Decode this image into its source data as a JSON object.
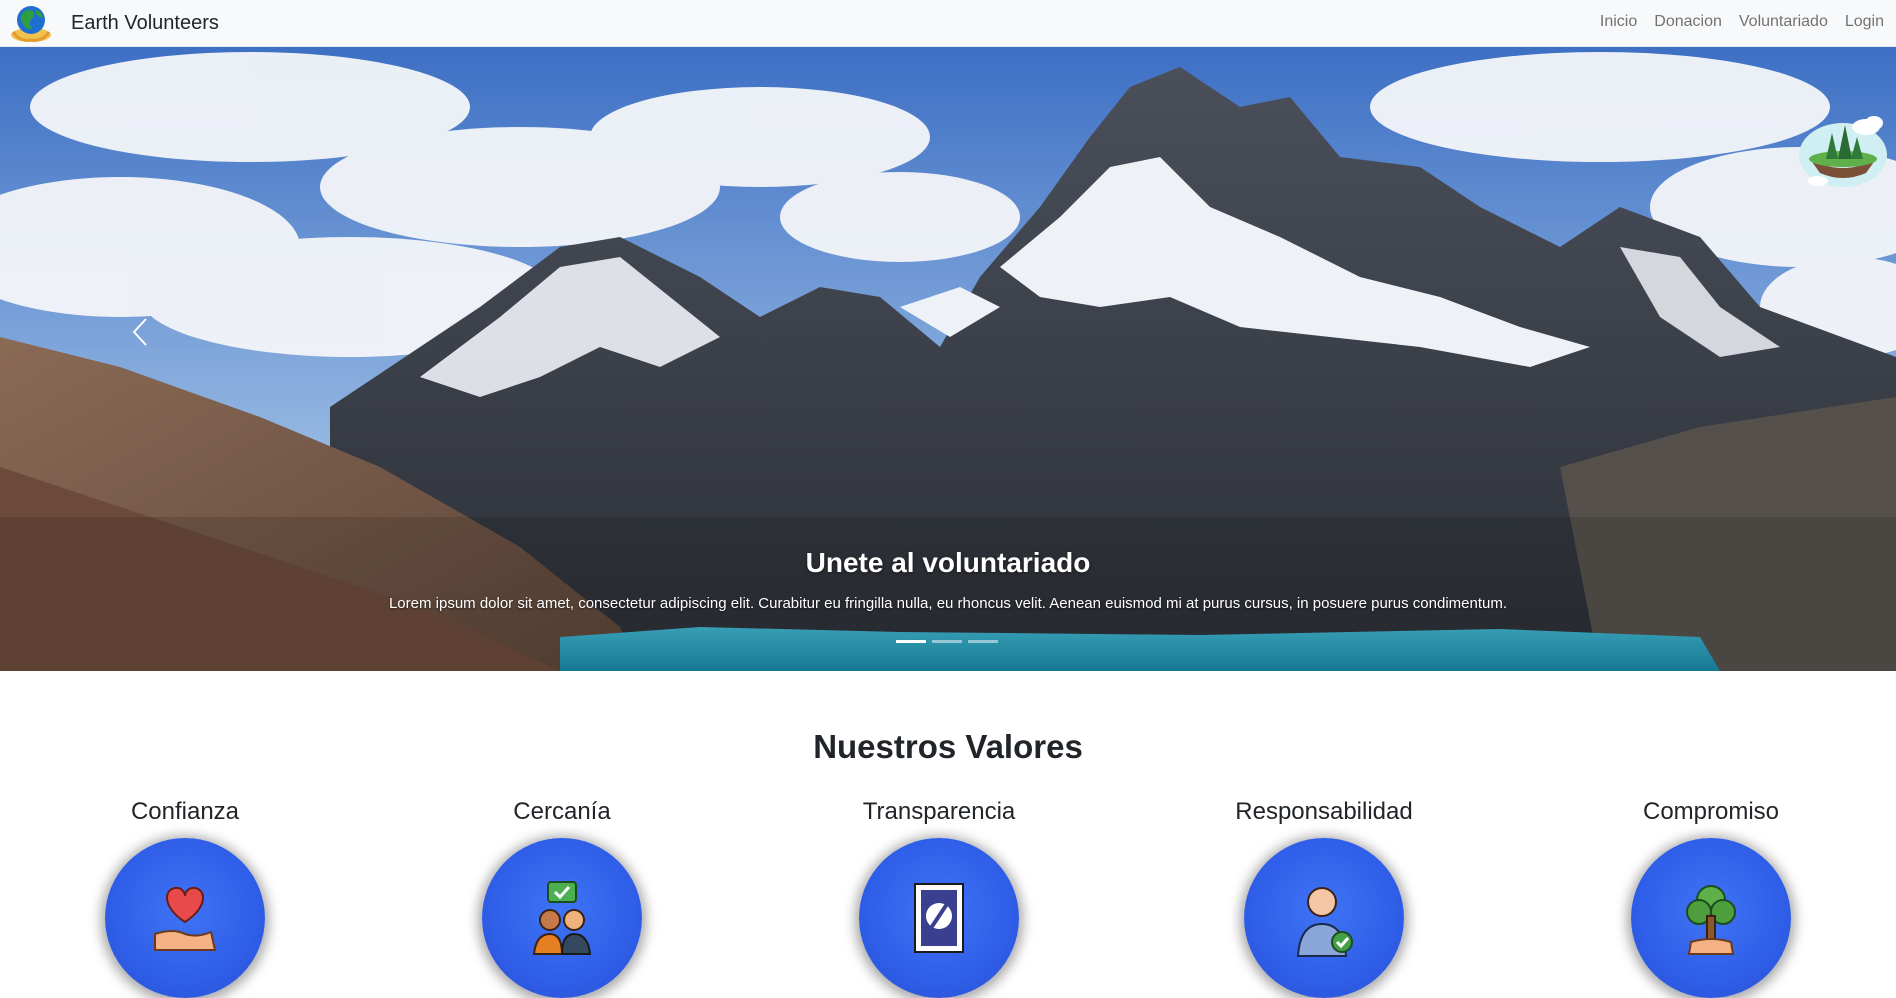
{
  "navbar": {
    "brand": "Earth Volunteers",
    "links": [
      "Inicio",
      "Donacion",
      "Voluntariado",
      "Login"
    ]
  },
  "carousel": {
    "title": "Unete al voluntariado",
    "text": "Lorem ipsum dolor sit amet, consectetur adipiscing elit. Curabitur eu fringilla nulla, eu rhoncus velit. Aenean euismod mi at purus cursus, in posuere purus condimentum.",
    "slide_count": 3,
    "active_slide": 1
  },
  "values": {
    "title": "Nuestros Valores",
    "items": [
      {
        "label": "Confianza",
        "icon": "heart-hand-icon"
      },
      {
        "label": "Cercanía",
        "icon": "people-chat-icon"
      },
      {
        "label": "Transparencia",
        "icon": "document-icon"
      },
      {
        "label": "Responsabilidad",
        "icon": "person-check-icon"
      },
      {
        "label": "Compromiso",
        "icon": "tree-icon"
      }
    ]
  },
  "colors": {
    "navbar_bg": "#f8f9fa",
    "value_circle": "#2f5ee8"
  }
}
